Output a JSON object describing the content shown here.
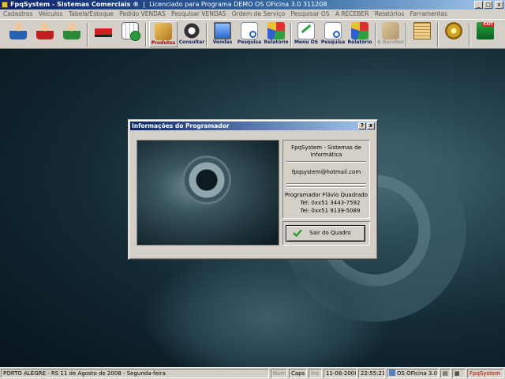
{
  "window": {
    "title": "FpqSystem - Sistemas Comerciais ®",
    "license": "Licenciado para  Programa DEMO OS OFicina 3.0 311208",
    "controls": [
      "_",
      "□",
      "x"
    ]
  },
  "menu": [
    "Cadastros",
    "Veículos",
    "Tabela/Estoque",
    "Pedido VENDAS",
    "Pesquisar VENDAS",
    "Ordem de Serviço",
    "Pesquisar OS",
    "A RECEBER",
    "Relatórios",
    "Ferramentas"
  ],
  "toolbar": {
    "produtos": "Produtos",
    "consultar": "Consultar",
    "vendas": "Vendas",
    "pesquisa1": "Pesquisa",
    "relatorio1": "Relatório",
    "menu_os": "Menu OS",
    "pesquisa2": "Pesquisa",
    "relatorio2": "Relatório",
    "a_receber": "A Receber",
    "exit_badge": "EXIT"
  },
  "dialog": {
    "title": "Informações do Programador",
    "help": "?",
    "close": "x",
    "company": "FpqSystem - Sistemas de Informática",
    "email": "fpqsystem@hotmail.com",
    "programmer": "Programador Flávio Quadrado",
    "tel1": "Tel: 0xx51 3443-7592",
    "tel2": "Tel: 0xx51 9139-5089",
    "exit_button": "Sair do Quadro"
  },
  "status": {
    "location_date": "PORTO ALEGRE - RS 11 de Agosto de 2008 - Segunda-feira",
    "num": "Num",
    "caps": "Caps",
    "ins": "Ins",
    "date": "11-08-2008",
    "time": "22:55:21",
    "version": "OS OFicina 3.0",
    "brand": "FpqSystem"
  },
  "colors": {
    "titlebar": "#0a246a",
    "chrome": "#d4d0c8",
    "accent_red": "#c00000"
  }
}
